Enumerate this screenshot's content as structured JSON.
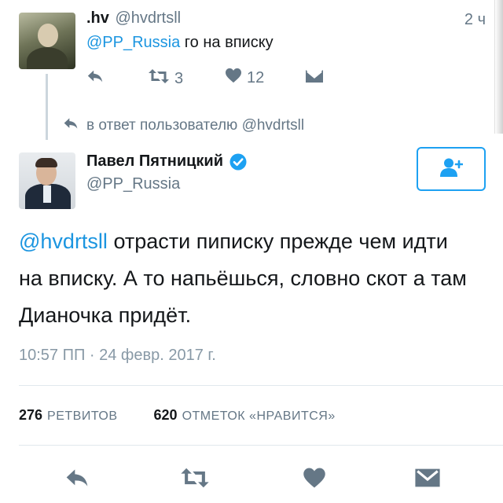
{
  "parent_tweet": {
    "display_name": ".hv",
    "handle": "@hvdrtsll",
    "time_ago": "2 ч",
    "mention": "@PP_Russia",
    "text": " го на вписку",
    "retweet_count": "3",
    "like_count": "12"
  },
  "reply_indicator": {
    "text": "в ответ пользователю @hvdrtsll"
  },
  "main_tweet": {
    "display_name": "Павел Пятницкий",
    "handle": "@PP_Russia",
    "mention": "@hvdrtsll",
    "text": " отрасти пиписку прежде чем идти на вписку. А то напьёшься, словно скот а там Дианочка придёт.",
    "timestamp": "10:57 ПП · 24 февр. 2017 г.",
    "retweets": {
      "count": "276",
      "label": "РЕТВИТОВ"
    },
    "likes": {
      "count": "620",
      "label": "ОТМЕТОК «НРАВИТСЯ»"
    }
  },
  "icons": {
    "reply": "reply-icon",
    "retweet": "retweet-icon",
    "like": "heart-icon",
    "message": "envelope-icon",
    "verified": "verified-badge-icon",
    "follow": "add-user-icon"
  },
  "colors": {
    "accent": "#1da1f2",
    "link": "#1b95e0",
    "icon_gray": "#657786",
    "text": "#14171a"
  }
}
